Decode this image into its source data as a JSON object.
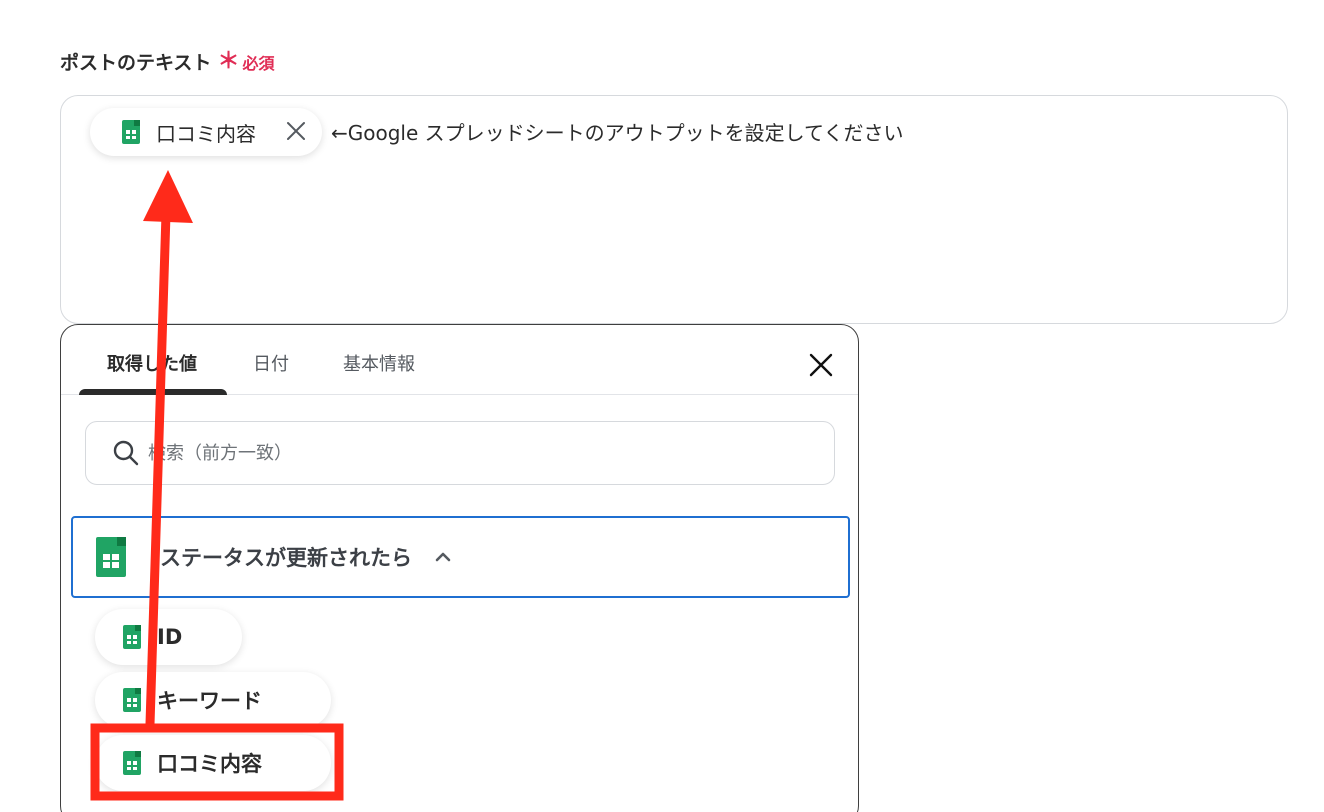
{
  "field": {
    "label": "ポストのテキスト",
    "required_mark": "＊",
    "required_label": "必須"
  },
  "editor": {
    "chip_label": "口コミ内容",
    "hint": "←Google スプレッドシートのアウトプットを設定してください"
  },
  "panel": {
    "tabs": [
      {
        "label": "取得した値",
        "active": true
      },
      {
        "label": "日付",
        "active": false
      },
      {
        "label": "基本情報",
        "active": false
      }
    ],
    "search_placeholder": "検索（前方一致）",
    "group": {
      "label": "ステータスが更新されたら",
      "expanded": true
    },
    "items": [
      {
        "label": "ID"
      },
      {
        "label": "キーワード"
      },
      {
        "label": "口コミ内容",
        "highlighted": true
      }
    ]
  },
  "colors": {
    "required": "#e02d55",
    "accent_border": "#1f6fd1",
    "sheets_green": "#20a464",
    "annotation_red": "#ff2a1a"
  },
  "icons": [
    "sheets-icon",
    "close-icon",
    "search-icon",
    "chevron-up-icon"
  ]
}
